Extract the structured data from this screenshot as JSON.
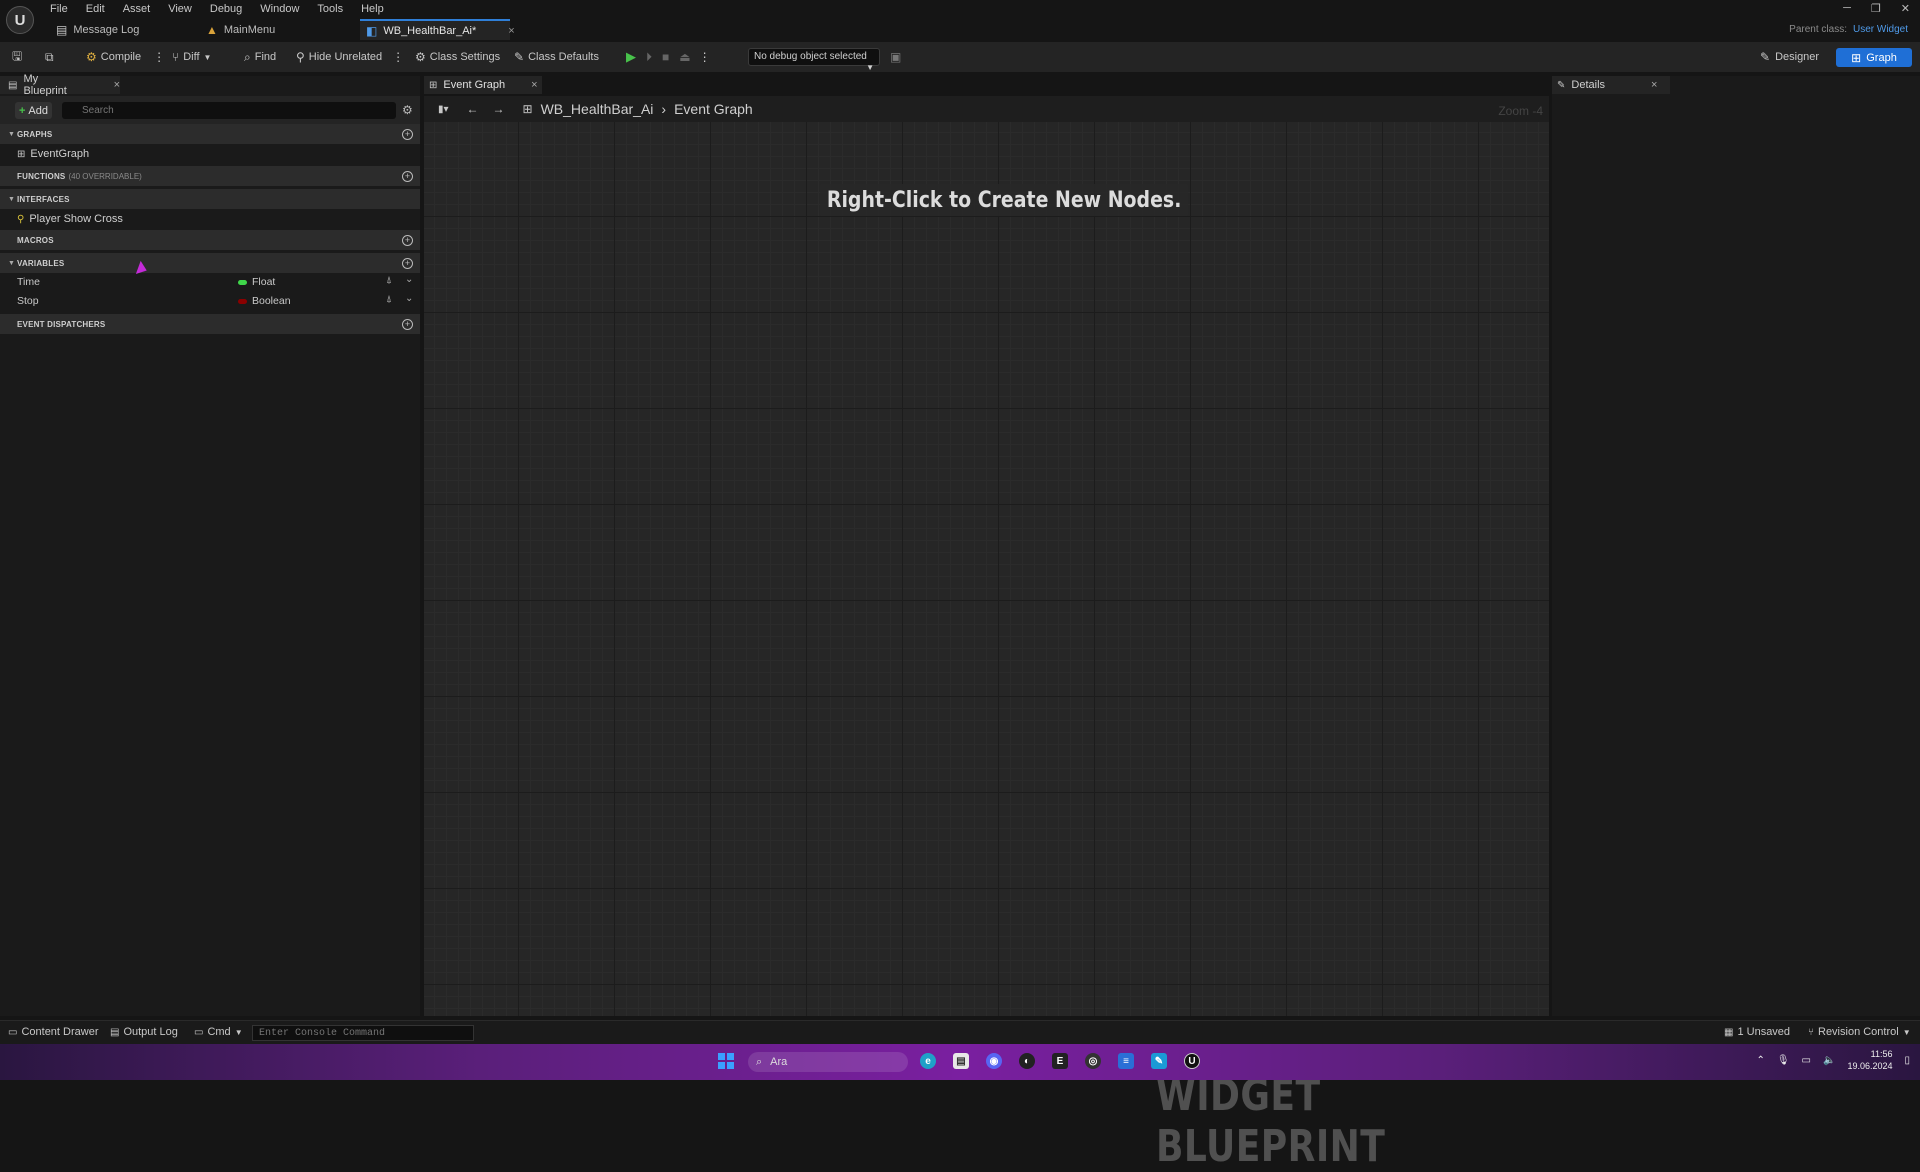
{
  "menu": [
    "File",
    "Edit",
    "Asset",
    "View",
    "Debug",
    "Window",
    "Tools",
    "Help"
  ],
  "doc_tabs": [
    {
      "label": "Message Log",
      "icon": "message-log-icon"
    },
    {
      "label": "MainMenu",
      "icon": "widget-icon"
    },
    {
      "label": "WB_HealthBar_Ai*",
      "icon": "blueprint-icon",
      "close": "×"
    }
  ],
  "parent_class": {
    "label": "Parent class:",
    "value": "User Widget"
  },
  "toolbar": {
    "compile": "Compile",
    "diff": "Diff",
    "find": "Find",
    "hide_unrelated": "Hide Unrelated",
    "class_settings": "Class Settings",
    "class_defaults": "Class Defaults",
    "debug_object": "No debug object selected",
    "designer": "Designer",
    "graph": "Graph"
  },
  "my_blueprint": {
    "tab": "My Blueprint",
    "add": "Add",
    "search_placeholder": "Search",
    "sections": {
      "graphs": "GRAPHS",
      "functions": "FUNCTIONS",
      "functions_sub": "(40 OVERRIDABLE)",
      "interfaces": "INTERFACES",
      "macros": "MACROS",
      "variables": "VARIABLES",
      "event_dispatchers": "EVENT DISPATCHERS"
    },
    "graph_items": [
      "EventGraph"
    ],
    "interface_items": [
      "Player Show Cross"
    ],
    "variables": [
      {
        "name": "Time",
        "type": "Float",
        "color": "#3fd64a"
      },
      {
        "name": "Stop",
        "type": "Boolean",
        "color": "#8b0000"
      }
    ]
  },
  "event_graph": {
    "tab": "Event Graph",
    "breadcrumb_root": "WB_HealthBar_Ai",
    "breadcrumb_leaf": "Event Graph",
    "zoom": "Zoom -4",
    "hint": "Right-Click to Create New Nodes.",
    "watermark": "WIDGET BLUEPRINT"
  },
  "details": {
    "tab": "Details"
  },
  "statusbar": {
    "content_drawer": "Content Drawer",
    "output_log": "Output Log",
    "cmd": "Cmd",
    "console_placeholder": "Enter Console Command",
    "unsaved": "1 Unsaved",
    "revision_control": "Revision Control"
  },
  "taskbar": {
    "search": "Ara",
    "time": "11:56",
    "date": "19.06.2024"
  },
  "colors": {
    "accent": "#1f6fd6",
    "play": "#48c24b"
  }
}
